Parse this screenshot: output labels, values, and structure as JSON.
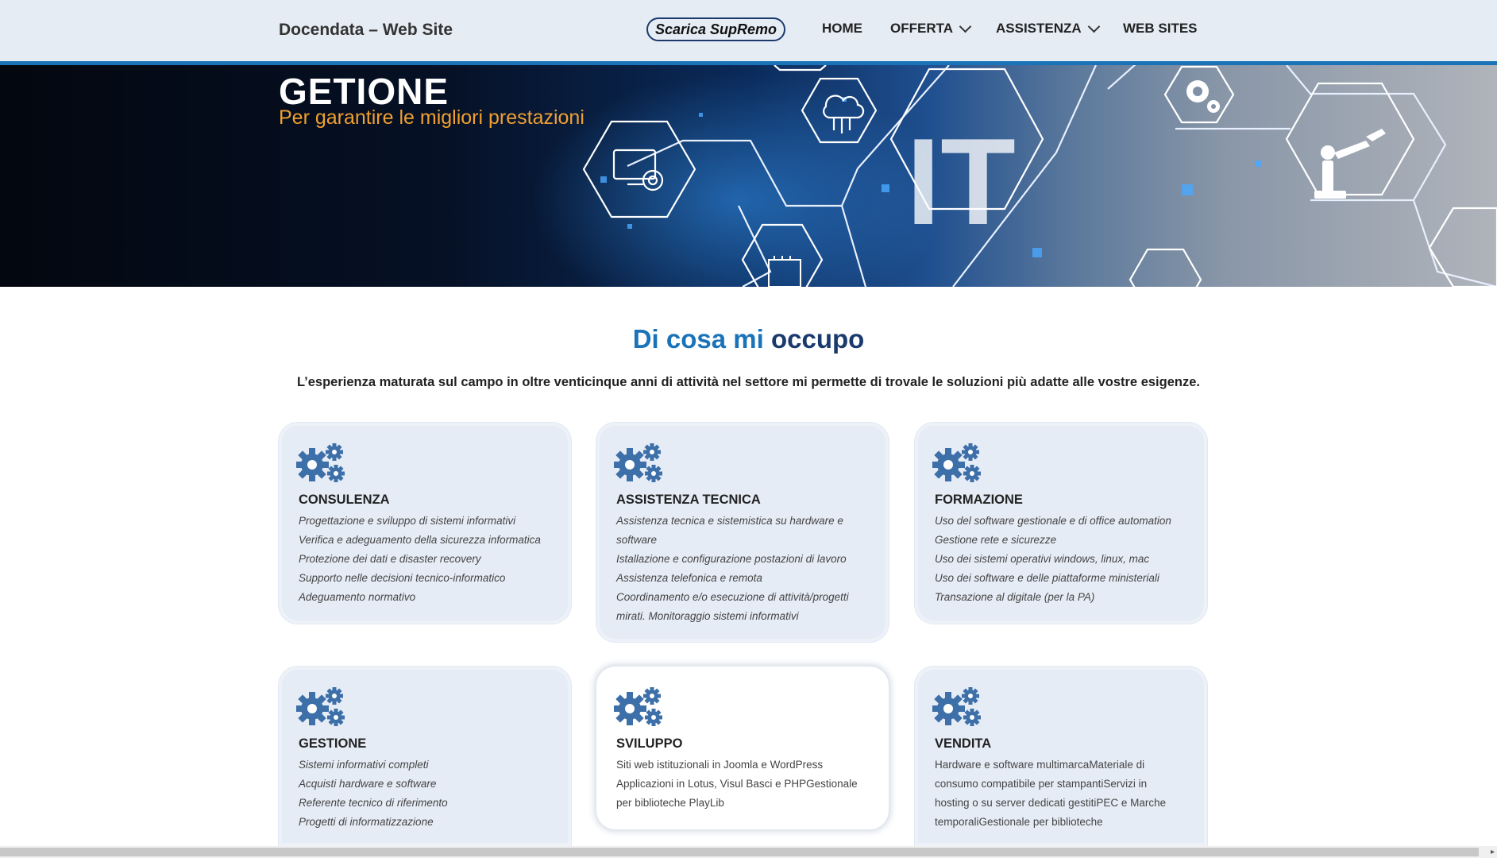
{
  "header": {
    "site_title": "Docendata – Web Site",
    "cta_label": "Scarica SupRemo",
    "nav": {
      "home": "HOME",
      "offerta": "OFFERTA",
      "assistenza": "ASSISTENZA",
      "web_sites": "WEB SITES"
    }
  },
  "hero": {
    "title": "GETIONE",
    "subtitle": "Per garantire le migliori prestazioni",
    "big_text": "IT"
  },
  "section": {
    "title_a": "Di cosa mi",
    "title_b": "occupo",
    "lead": "L’esperienza maturata sul campo in oltre venticinque anni di attività nel settore mi permette di trovale le soluzioni più adatte alle vostre esigenze."
  },
  "cards": [
    {
      "title": "CONSULENZA",
      "items": [
        "Progettazione e sviluppo di sistemi informativi",
        "Verifica e adeguamento della sicurezza informatica",
        "Protezione dei dati e disaster recovery",
        "Supporto nelle decisioni tecnico-informatico",
        "Adeguamento normativo"
      ]
    },
    {
      "title": "ASSISTENZA TECNICA",
      "items": [
        "Assistenza tecnica e sistemistica su hardware e software",
        "Istallazione e configurazione postazioni di lavoro",
        "Assistenza telefonica e remota",
        "Coordinamento e/o esecuzione di attività/progetti mirati. Monitoraggio sistemi informativi"
      ]
    },
    {
      "title": "FORMAZIONE",
      "items": [
        "Uso del software gestionale e di office automation",
        "Gestione rete e sicurezze",
        "Uso dei sistemi operativi windows, linux, mac",
        "Uso dei software e delle piattaforme ministeriali",
        "Transazione al digitale (per la PA)"
      ]
    },
    {
      "title": "GESTIONE",
      "items": [
        "Sistemi informativi completi",
        "Acquisti hardware e software",
        "Referente tecnico di riferimento",
        "Progetti di informatizzazione"
      ]
    },
    {
      "title": "SVILUPPO",
      "text": "Siti web istituzionali in Joomla e WordPress Applicazioni in Lotus, Visul Basci e PHPGestionale per biblioteche PlayLib"
    },
    {
      "title": "VENDITA",
      "text": "Hardware e software multimarcaMateriale di consumo compatibile per stampantiServizi in hosting o su server dedicati gestitiPEC e Marche temporaliGestionale per biblioteche"
    }
  ],
  "colors": {
    "accent": "#1a73b8",
    "navy": "#1a3a6e",
    "hero_subtitle": "#f0a030",
    "card_bg": "#e6ecf6",
    "gear": "#3d6fa8"
  },
  "icons": [
    "gears-icon",
    "chevron-down-icon",
    "circuit-cloud-icon",
    "monitor-gear-icon",
    "gear-icon",
    "robot-arm-icon",
    "chip-icon"
  ]
}
